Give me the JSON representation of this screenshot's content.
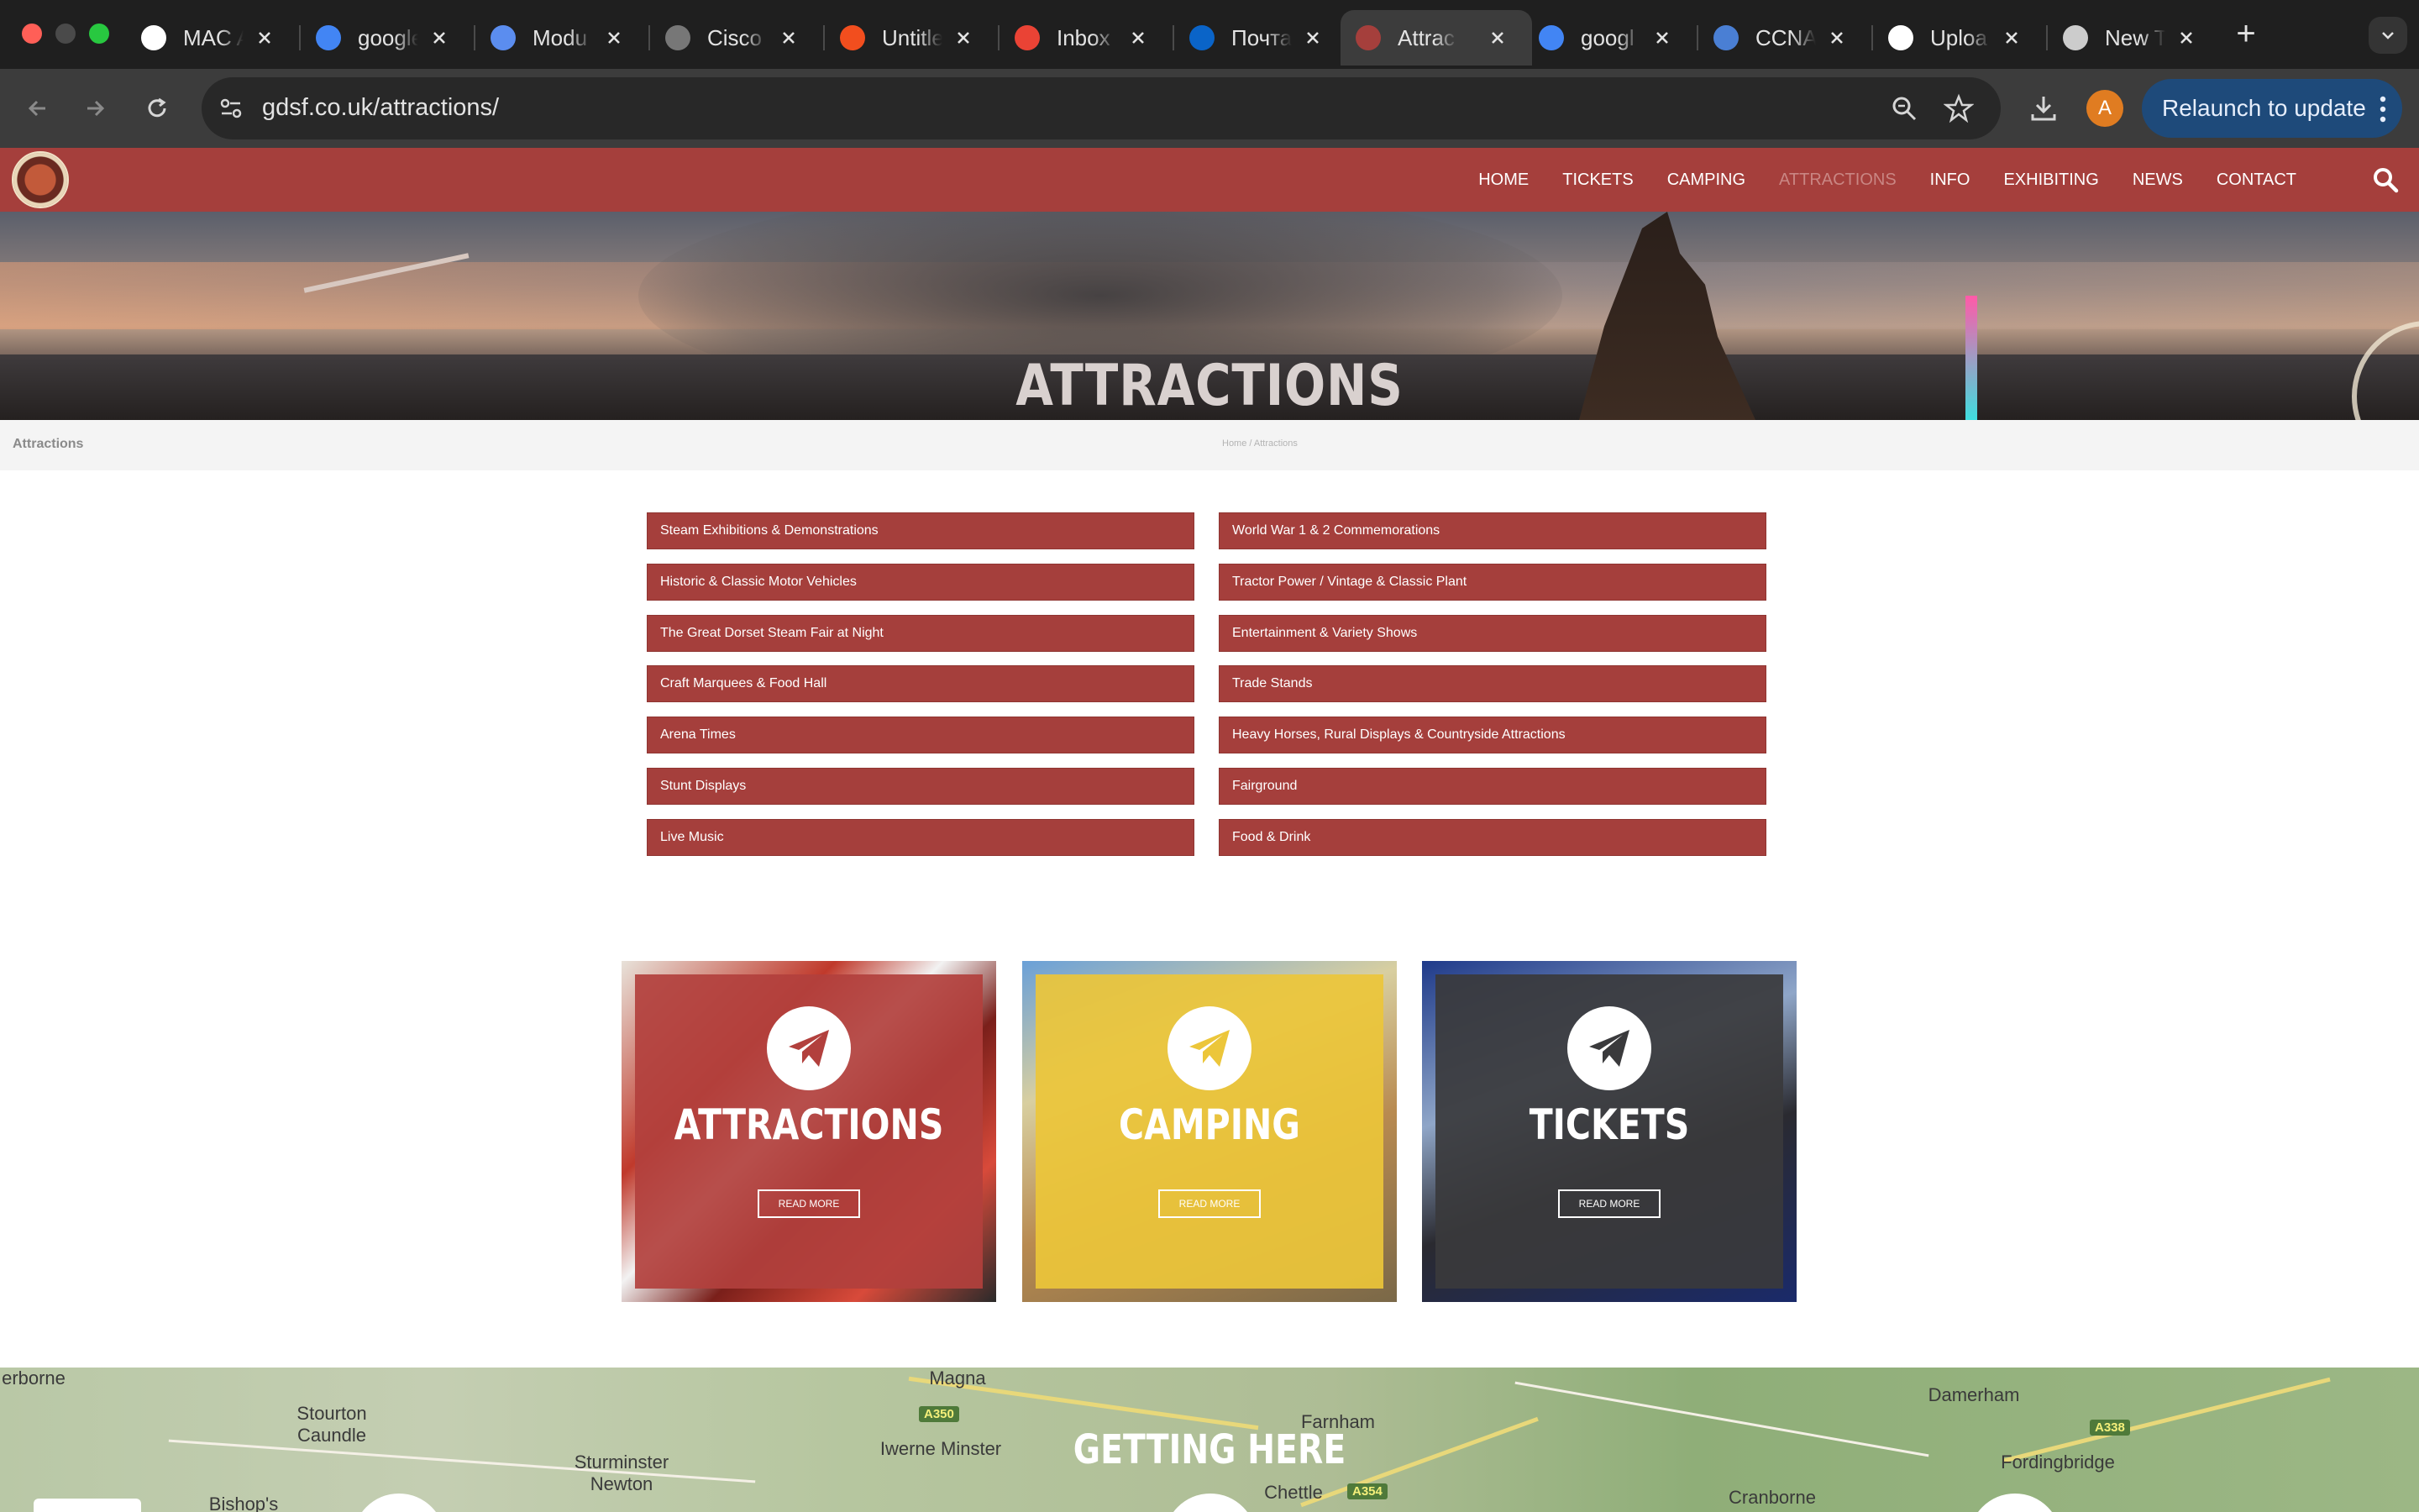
{
  "browser": {
    "tabs": [
      {
        "title": "MAC A",
        "icon": "openai-icon",
        "color": "#ffffff"
      },
      {
        "title": "google",
        "icon": "google-icon",
        "color": "#4285f4"
      },
      {
        "title": "Modu",
        "icon": "triangle-app-icon",
        "color": "#5b8def"
      },
      {
        "title": "Cisco",
        "icon": "cisco-icon",
        "color": "#777777"
      },
      {
        "title": "Untitle",
        "icon": "figma-icon",
        "color": "#f24e1e"
      },
      {
        "title": "Inbox",
        "icon": "gmail-icon",
        "color": "#ea4335"
      },
      {
        "title": "Почта",
        "icon": "outlook-icon",
        "color": "#0a64c8"
      },
      {
        "title": "Attrac",
        "icon": "gdsf-icon",
        "color": "#a53f3c",
        "active": true
      },
      {
        "title": "googl",
        "icon": "google-icon",
        "color": "#4285f4"
      },
      {
        "title": "CCNA",
        "icon": "link-icon",
        "color": "#4a7fd4"
      },
      {
        "title": "Uploa",
        "icon": "github-icon",
        "color": "#ffffff"
      },
      {
        "title": "New T",
        "icon": "chrome-icon",
        "color": "#cccccc"
      }
    ],
    "url": "gdsf.co.uk/attractions/",
    "relaunch_label": "Relaunch to update",
    "profile_initial": "A"
  },
  "site": {
    "nav": [
      {
        "label": "HOME"
      },
      {
        "label": "TICKETS"
      },
      {
        "label": "CAMPING"
      },
      {
        "label": "ATTRACTIONS",
        "current": true
      },
      {
        "label": "INFO"
      },
      {
        "label": "EXHIBITING"
      },
      {
        "label": "NEWS"
      },
      {
        "label": "CONTACT"
      }
    ],
    "hero_title": "ATTRACTIONS",
    "breadcrumb_title": "Attractions",
    "breadcrumb_path": "Home / Attractions",
    "attractions_left": [
      "Steam Exhibitions & Demonstrations",
      "Historic & Classic Motor Vehicles",
      "The Great Dorset Steam Fair at Night",
      "Craft Marquees & Food Hall",
      "Arena Times",
      "Stunt Displays",
      "Live Music"
    ],
    "attractions_right": [
      "World War 1 & 2 Commemorations",
      "Tractor Power / Vintage & Classic Plant",
      "Entertainment & Variety Shows",
      "Trade Stands",
      "Heavy Horses, Rural Displays & Countryside Attractions",
      "Fairground",
      "Food & Drink"
    ],
    "cards": [
      {
        "title": "ATTRACTIONS",
        "button": "READ MORE",
        "overlay_color": "#b2403d",
        "icon": "paper-plane-icon"
      },
      {
        "title": "CAMPING",
        "button": "READ MORE",
        "overlay_color": "#ecc63a",
        "icon": "paper-plane-icon"
      },
      {
        "title": "TICKETS",
        "button": "READ MORE",
        "overlay_color": "#3a3a3c",
        "icon": "paper-plane-icon"
      }
    ],
    "colors": {
      "brand_red": "#a53f3c",
      "camping_yellow": "#ecc63a",
      "tickets_dark": "#3a3a3c"
    },
    "map": {
      "title": "GETTING HERE",
      "places": [
        "Stourton Caundle",
        "Sturminster Newton",
        "Iwerne Minster",
        "Farnham",
        "Damerham",
        "Fordingbridge",
        "Cranborne",
        "Chettle",
        "Bishop's",
        "Magna",
        "erborne"
      ],
      "roads": [
        "A350",
        "A354",
        "A338"
      ]
    }
  }
}
